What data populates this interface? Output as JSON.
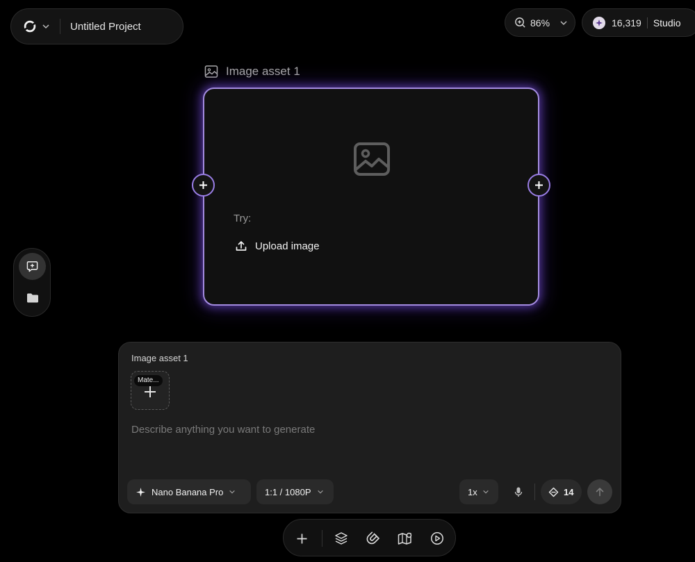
{
  "header": {
    "project_title": "Untitled Project",
    "logo_icon": "app-logo-icon",
    "zoom_level": "86%",
    "credits": "16,319",
    "studio_label": "Studio"
  },
  "canvas": {
    "asset_title": "Image asset 1",
    "try_label": "Try:",
    "upload_label": "Upload image",
    "accent_color": "#9a7ee6"
  },
  "left_toolbar": {
    "items": [
      "add-comment-icon",
      "folder-icon"
    ]
  },
  "prompt_panel": {
    "title": "Image asset 1",
    "material_label": "Mate...",
    "input_value": "",
    "input_placeholder": "Describe anything you want to generate",
    "model_label": "Nano Banana Pro",
    "ratio_label": "1:1 / 1080P",
    "count_label": "1x",
    "cost_label": "14"
  },
  "bottom_toolbar": {
    "items": [
      "plus-icon",
      "layers-icon",
      "magnet-icon",
      "map-icon",
      "play-icon"
    ]
  }
}
